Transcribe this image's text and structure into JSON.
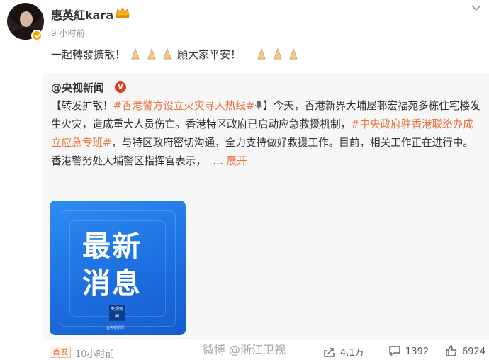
{
  "user": {
    "name": "惠英紅kara",
    "time": "9 小时前",
    "post_text_a": "一起轉發擴散！",
    "post_text_b": "願大家平安！"
  },
  "repost": {
    "source": "@央视新闻",
    "source_badge": "V",
    "seg1": "【转发扩散！",
    "tag1": "#香港警方设立火灾寻人热线#",
    "seg2": "】今天，香港新界大埔屋邨宏福苑多栋住宅楼发生火灾，造成重大人员伤亡。香港特区政府已启动应急救援机制，",
    "tag2": "#中央政府驻香港联络办成立应急专班#",
    "seg3": "，与特区政府密切沟通，全力支持做好救援工作。目前，相关工作正在进行中。香港警务处大埔警区指挥官表示，",
    "ellipsis": "…",
    "more": "展开",
    "image": {
      "line1": "最新",
      "line2": "消息",
      "logo": "央视新闻",
      "footer": "@央视新闻"
    }
  },
  "footer": {
    "first_badge": "首发",
    "time": "10小时前",
    "watermark": "微博 @浙江卫视",
    "share": "4.1万",
    "comments": "1392",
    "likes": "6924"
  },
  "colors": {
    "accent": "#eb7340",
    "image_blue": "#1f73e3",
    "badge_orange": "#f7a400"
  }
}
